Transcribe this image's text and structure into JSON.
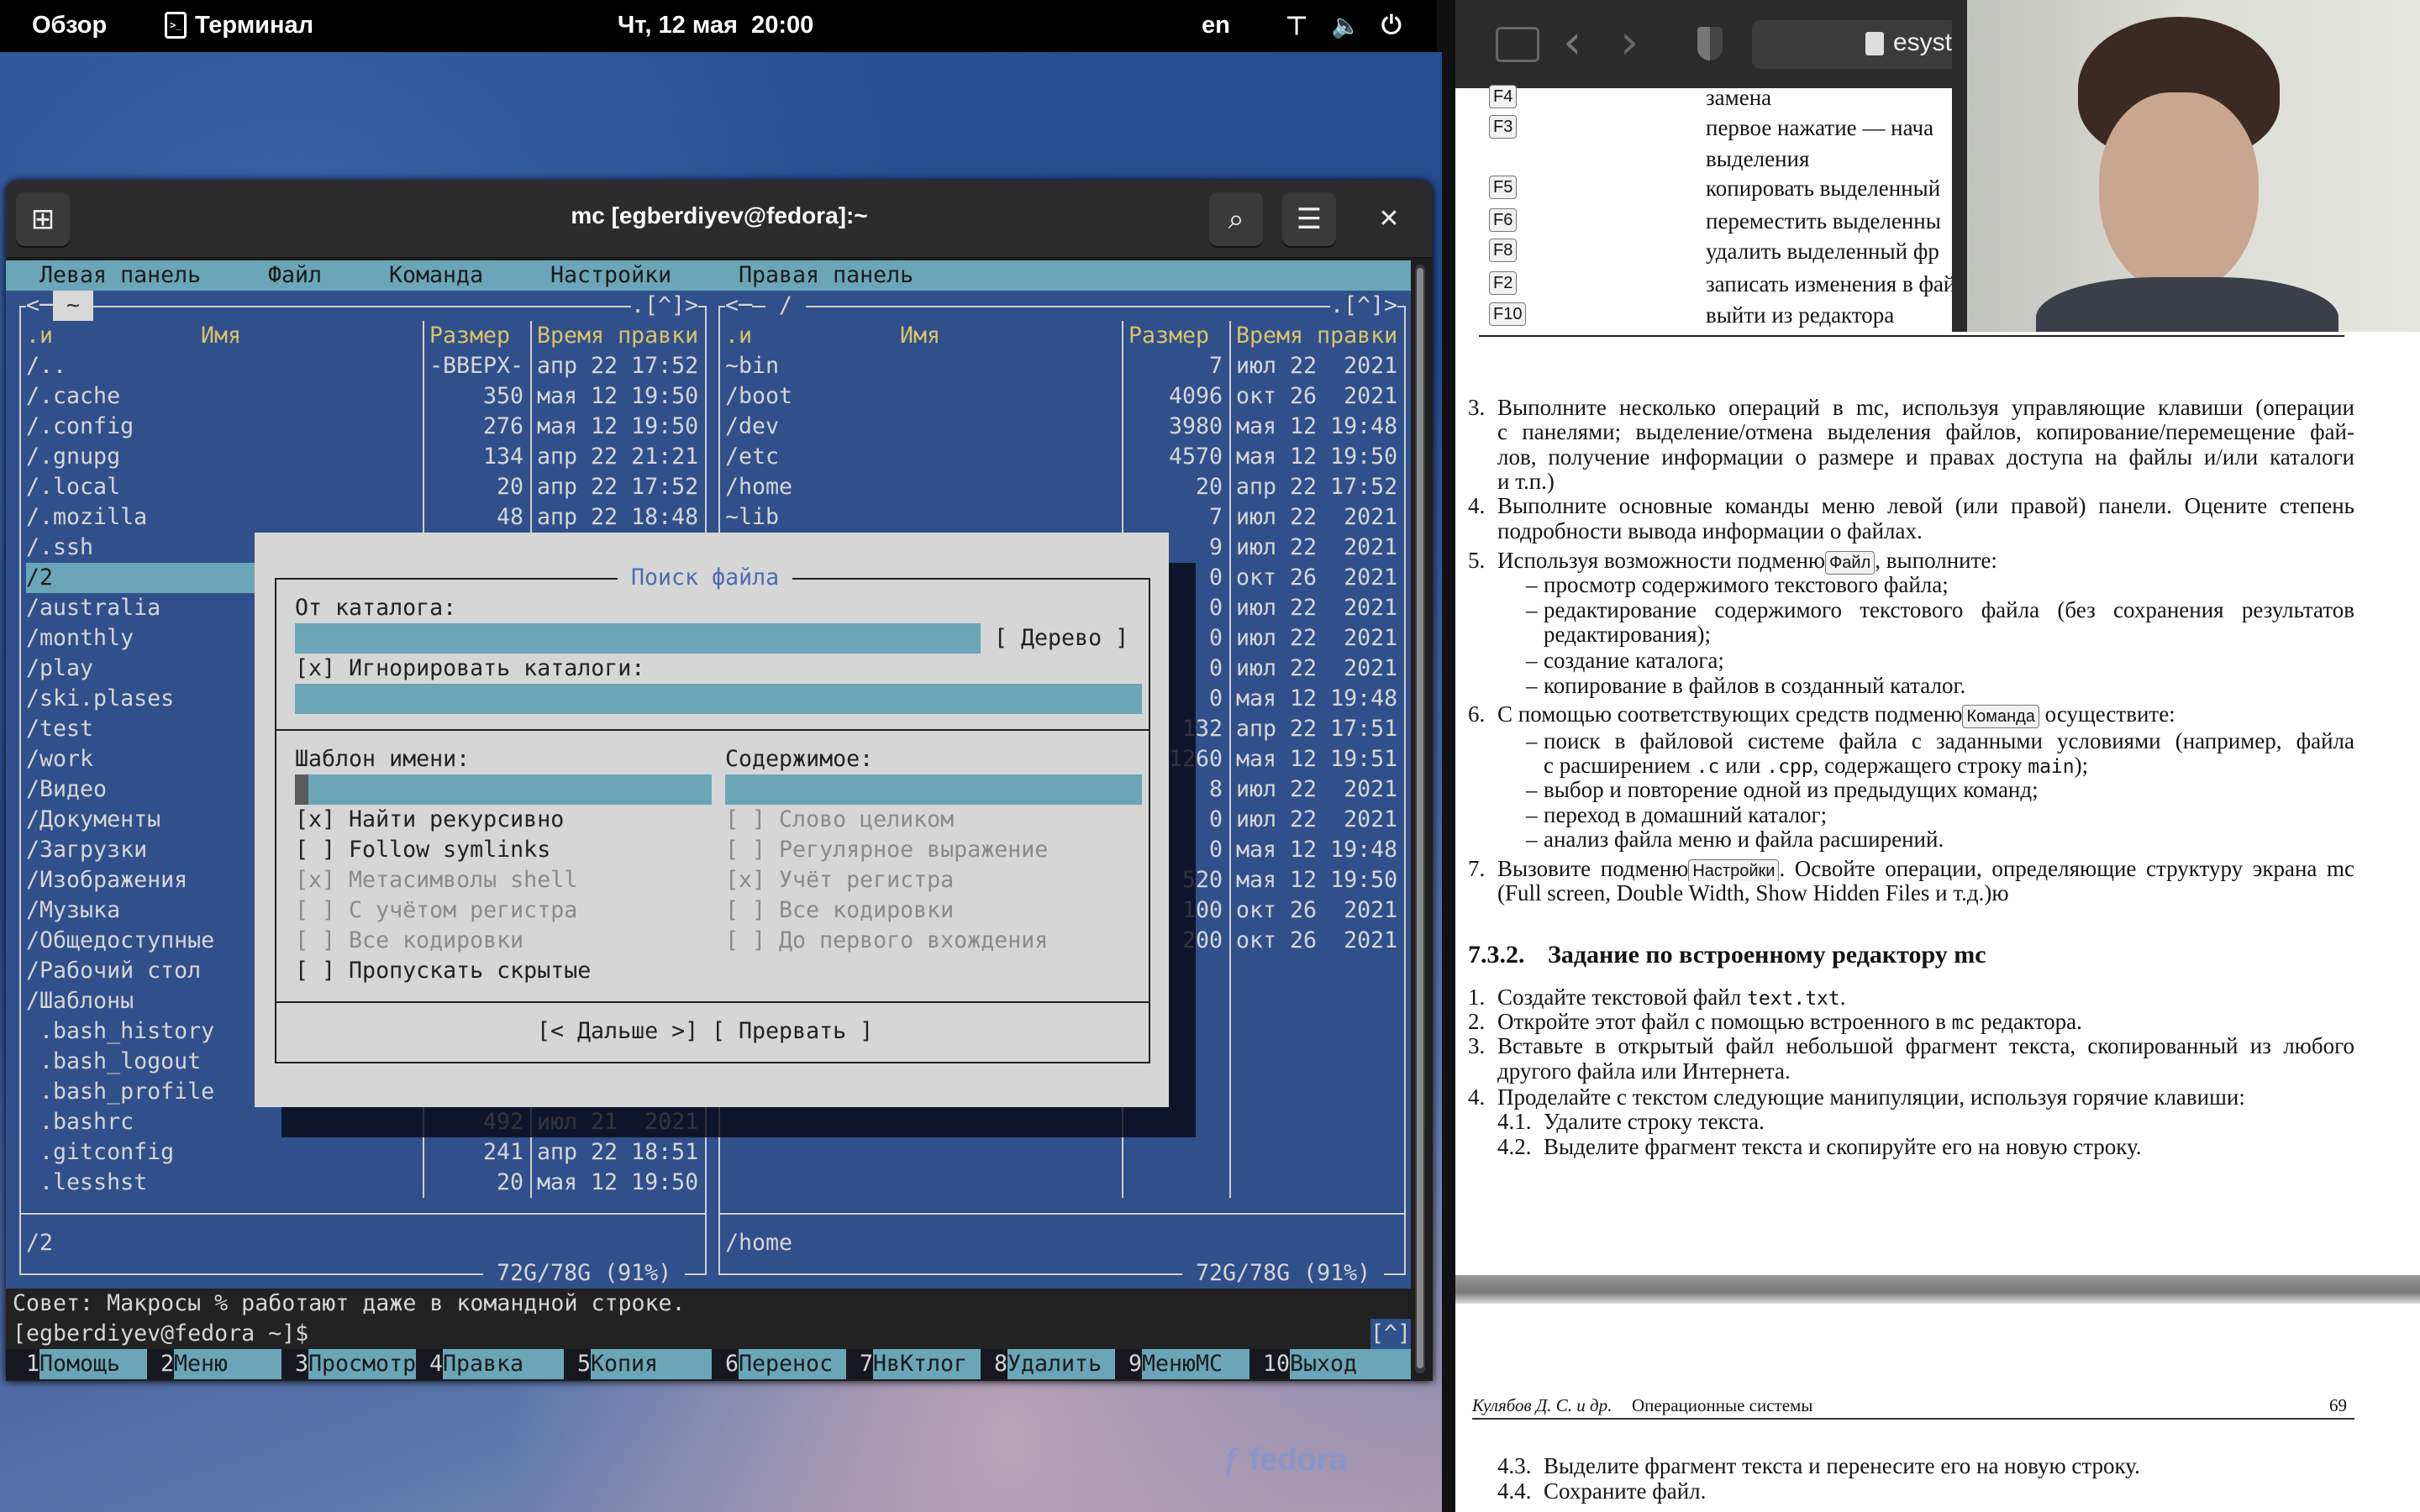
{
  "topbar": {
    "overview": "Обзор",
    "app": "Терминал",
    "clock": "Чт, 12 мая  20:00",
    "lang": "en"
  },
  "desktop": {
    "logo": "fedora"
  },
  "terminal": {
    "title": "mc [egberdiyev@fedora]:~"
  },
  "mc": {
    "menu": [
      "Левая панель",
      "Файл",
      "Команда",
      "Настройки",
      "Правая панель"
    ],
    "left": {
      "path": "~",
      "nav_left": "<",
      "nav_right": ".[^]>",
      "headers": {
        "sort": ".и",
        "name": "Имя",
        "size": "Размер",
        "mtime": "Время правки"
      },
      "selected_index": 7,
      "rows": [
        {
          "name": "/..",
          "size": "-ВВЕРХ-",
          "mtime": "апр 22 17:52"
        },
        {
          "name": "/.cache",
          "size": "350",
          "mtime": "мая 12 19:50"
        },
        {
          "name": "/.config",
          "size": "276",
          "mtime": "мая 12 19:50"
        },
        {
          "name": "/.gnupg",
          "size": "134",
          "mtime": "апр 22 21:21"
        },
        {
          "name": "/.local",
          "size": "20",
          "mtime": "апр 22 17:52"
        },
        {
          "name": "/.mozilla",
          "size": "48",
          "mtime": "апр 22 18:48"
        },
        {
          "name": "/.ssh"
        },
        {
          "name": "/2"
        },
        {
          "name": "/australia"
        },
        {
          "name": "/monthly"
        },
        {
          "name": "/play"
        },
        {
          "name": "/ski.plases"
        },
        {
          "name": "/test"
        },
        {
          "name": "/work"
        },
        {
          "name": "/Видео"
        },
        {
          "name": "/Документы"
        },
        {
          "name": "/Загрузки"
        },
        {
          "name": "/Изображения"
        },
        {
          "name": "/Музыка"
        },
        {
          "name": "/Общедоступные"
        },
        {
          "name": "/Рабочий стол"
        },
        {
          "name": "/Шаблоны"
        },
        {
          "name": " .bash_history"
        },
        {
          "name": " .bash_logout"
        },
        {
          "name": " .bash_profile"
        },
        {
          "name": " .bashrc",
          "size": "492",
          "mtime": "июл 21  2021"
        },
        {
          "name": " .gitconfig",
          "size": "241",
          "mtime": "апр 22 18:51"
        },
        {
          "name": " .lesshst",
          "size": "20",
          "mtime": "мая 12 19:50"
        }
      ],
      "current_dir": "/2",
      "disk": " 72G/78G (91%) "
    },
    "right": {
      "path": " / ",
      "nav_left": "<",
      "nav_right": ".[^]>",
      "headers": {
        "sort": ".и",
        "name": "Имя",
        "size": "Размер",
        "mtime": "Время правки"
      },
      "rows": [
        {
          "name": "~bin",
          "size": "7",
          "mtime": "июл 22  2021"
        },
        {
          "name": "/boot",
          "size": "4096",
          "mtime": "окт 26  2021"
        },
        {
          "name": "/dev",
          "size": "3980",
          "mtime": "мая 12 19:48"
        },
        {
          "name": "/etc",
          "size": "4570",
          "mtime": "мая 12 19:50"
        },
        {
          "name": "/home",
          "size": "20",
          "mtime": "апр 22 17:52"
        },
        {
          "name": "~lib",
          "size": "7",
          "mtime": "июл 22  2021"
        },
        {
          "name": "",
          "size": "9",
          "mtime": "июл 22  2021"
        },
        {
          "name": "",
          "size": "0",
          "mtime": "окт 26  2021"
        },
        {
          "name": "",
          "size": "0",
          "mtime": "июл 22  2021"
        },
        {
          "name": "",
          "size": "0",
          "mtime": "июл 22  2021"
        },
        {
          "name": "",
          "size": "0",
          "mtime": "июл 22  2021"
        },
        {
          "name": "",
          "size": "0",
          "mtime": "мая 12 19:48"
        },
        {
          "name": "",
          "size": "132",
          "mtime": "апр 22 17:51"
        },
        {
          "name": "",
          "size": "1260",
          "mtime": "мая 12 19:51"
        },
        {
          "name": "",
          "size": "8",
          "mtime": "июл 22  2021"
        },
        {
          "name": "",
          "size": "0",
          "mtime": "июл 22  2021"
        },
        {
          "name": "",
          "size": "0",
          "mtime": "мая 12 19:48"
        },
        {
          "name": "",
          "size": "520",
          "mtime": "мая 12 19:50"
        },
        {
          "name": "",
          "size": "100",
          "mtime": "окт 26  2021"
        },
        {
          "name": "",
          "size": "200",
          "mtime": "окт 26  2021"
        }
      ],
      "current_dir": "/home",
      "disk": " 72G/78G (91%) "
    },
    "hint": "Совет: Макросы % работают даже в командной строке.",
    "prompt": "[egberdiyev@fedora ~]$",
    "subshell_marker": "[^]",
    "fkeys": [
      {
        "num": "1",
        "label": "Помощь"
      },
      {
        "num": "2",
        "label": "Меню"
      },
      {
        "num": "3",
        "label": "Просмотр"
      },
      {
        "num": "4",
        "label": "Правка"
      },
      {
        "num": "5",
        "label": "Копия"
      },
      {
        "num": "6",
        "label": "Перенос"
      },
      {
        "num": "7",
        "label": "НвКтлог"
      },
      {
        "num": "8",
        "label": "Удалить"
      },
      {
        "num": "9",
        "label": "МенюMC"
      },
      {
        "num": "10",
        "label": "Выход"
      }
    ],
    "dialog": {
      "title": " Поиск файла ",
      "from_dir_label": "От каталога:",
      "from_dir_value": "",
      "tree_button": "[ Дерево ]",
      "ignore_dirs": {
        "checked": true,
        "label": "Игнорировать каталоги:"
      },
      "ignore_dirs_value": "",
      "name_label": "Шаблон имени:",
      "name_value": "",
      "content_label": "Содержимое:",
      "content_value": "",
      "left_options": [
        {
          "checked": true,
          "label": "Найти рекурсивно",
          "disabled": false
        },
        {
          "checked": false,
          "label": "Follow symlinks",
          "disabled": false
        },
        {
          "checked": true,
          "label": "Метасимволы shell",
          "disabled": true
        },
        {
          "checked": false,
          "label": "С учётом регистра",
          "disabled": true
        },
        {
          "checked": false,
          "label": "Все кодировки",
          "disabled": true
        },
        {
          "checked": false,
          "label": "Пропускать скрытые",
          "disabled": false
        }
      ],
      "right_options": [
        {
          "checked": false,
          "label": "Слово целиком",
          "disabled": true
        },
        {
          "checked": false,
          "label": "Регулярное выражение",
          "disabled": true
        },
        {
          "checked": true,
          "label": "Учёт регистра",
          "disabled": true
        },
        {
          "checked": false,
          "label": "Все кодировки",
          "disabled": true
        },
        {
          "checked": false,
          "label": "До первого вхождения",
          "disabled": true
        }
      ],
      "ok_button": "[< Дальше >]",
      "cancel_button": "[ Прервать ]"
    }
  },
  "browser": {
    "url": "esyste"
  },
  "doc": {
    "table": [
      {
        "key": "F4",
        "text": "замена"
      },
      {
        "key": "F3",
        "text": "первое нажатие — нача"
      },
      {
        "key": "",
        "text": "выделения"
      },
      {
        "key": "F5",
        "text": "копировать выделенный"
      },
      {
        "key": "F6",
        "text": "переместить выделенны"
      },
      {
        "key": "F8",
        "text": "удалить выделенный фр"
      },
      {
        "key": "F2",
        "text": "записать изменения в файл"
      },
      {
        "key": "F10",
        "text": "выйти из редактора"
      }
    ],
    "l3a": "Выполните несколько операций в mc, используя управляющие клавиши (операции",
    "l3b": "с панелями; выделение/отмена выделения файлов, копирование/перемещение фай-",
    "l3c": "лов, получение информации о размере и правах доступа на файлы и/или каталоги",
    "l3d": "и т.п.)",
    "l4a": "Выполните основные команды меню левой (или правой) панели. Оцените степень",
    "l4b": "подробности вывода информации о файлах.",
    "l5a": "Используя возможности подменю",
    "l5k": "Файл",
    "l5b": ", выполните:",
    "l5_1": "просмотр содержимого текстового файла;",
    "l5_2a": "редактирование содержимого текстового файла (без сохранения результатов",
    "l5_2b": "редактирования);",
    "l5_3": "создание каталога;",
    "l5_4": "копирование в файлов в созданный каталог.",
    "l6a": "С помощью соответствующих средств подменю",
    "l6k": "Команда",
    "l6b": " осуществите:",
    "l6_1a": "поиск в файловой системе файла с заданными условиями (например, файла",
    "l6_1b": "с расширением ",
    "l6_1c": ".c",
    "l6_1d": " или ",
    "l6_1e": ".cpp",
    "l6_1f": ", содержащего строку ",
    "l6_1g": "main",
    "l6_1h": ");",
    "l6_2": "выбор и повторение одной из предыдущих команд;",
    "l6_3": "переход в домашний каталог;",
    "l6_4": "анализ файла меню и файла расширений.",
    "l7a": "Вызовите подменю",
    "l7k": "Настройки",
    "l7b": ". Освойте операции, определяющие структуру экрана mc",
    "l7c": "(Full screen, Double Width, Show Hidden Files и т.д.)ю",
    "heading_num": "7.3.2.",
    "heading": "Задание по встроенному редактору mc",
    "e1a": "Создайте текстовой файл ",
    "e1b": "text.txt",
    ".": ".",
    "e2a": "Откройте этот файл с помощью встроенного в ",
    "e2b": "mc",
    "e2c": " редактора.",
    "e3a": "Вставьте в открытый файл небольшой фрагмент текста, скопированный из любого",
    "e3b": "другого файла или Интернета.",
    "e4": "Проделайте с текстом следующие манипуляции, используя горячие клавиши:",
    "e41": "Удалите строку текста.",
    "e42": "Выделите фрагмент текста и скопируйте его на новую строку.",
    "footer_left": "Кулябов Д. С. и др.",
    "footer_title": "Операционные системы",
    "page": "69",
    "e43": "Выделите фрагмент текста и перенесите его на новую строку.",
    "e44": "Сохраните файл.",
    "nums": [
      "3.",
      "4.",
      "5.",
      "6.",
      "7.",
      "1.",
      "2.",
      "3.",
      "4.",
      "4.1.",
      "4.2.",
      "4.3.",
      "4.4."
    ],
    "dash": "–"
  }
}
